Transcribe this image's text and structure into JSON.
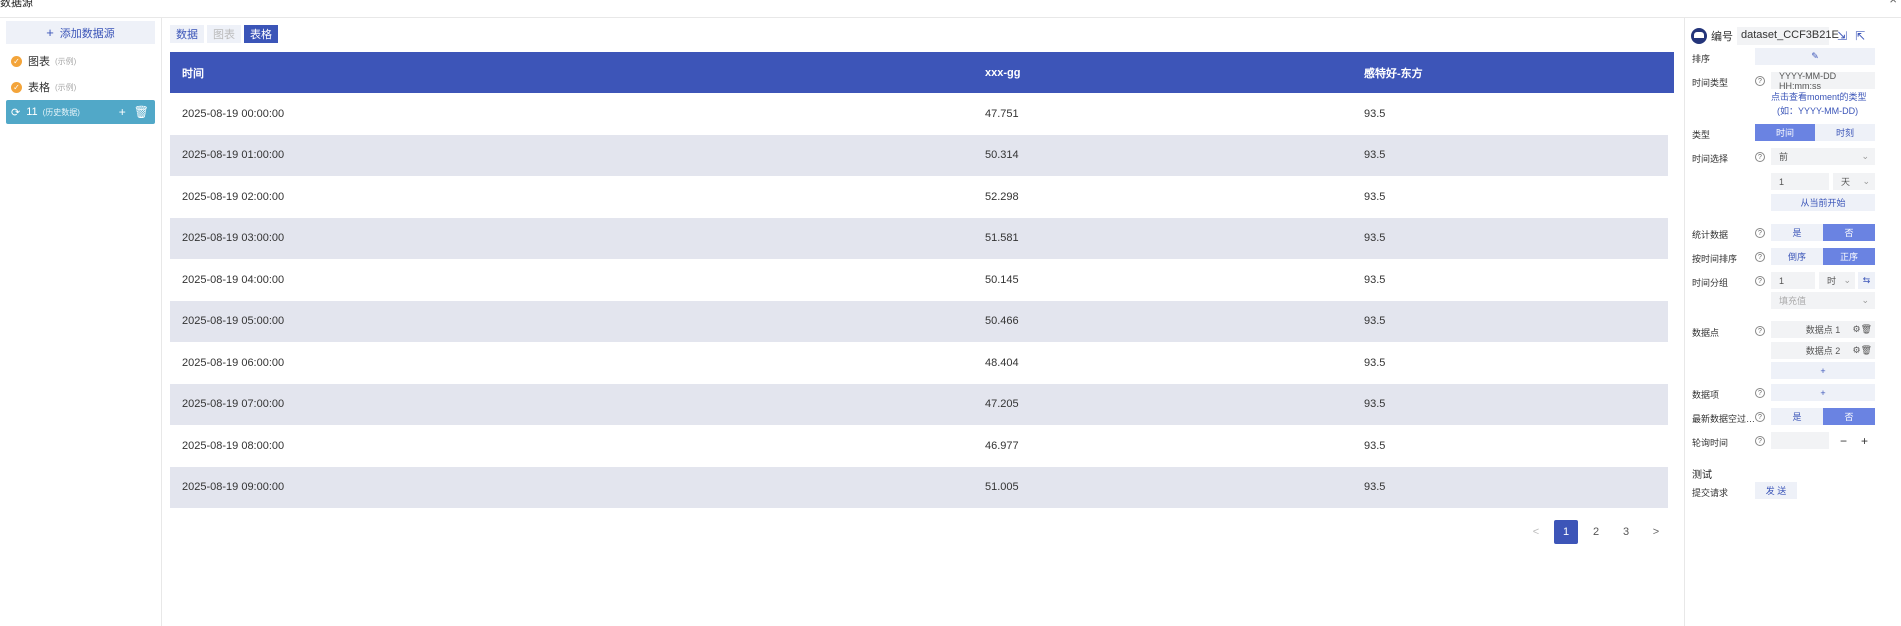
{
  "window": {
    "title": "数据源",
    "close_glyph": "×"
  },
  "sidebar": {
    "add_label": "添加数据源",
    "items": [
      {
        "label": "图表",
        "tag": "(示例)"
      },
      {
        "label": "表格",
        "tag": "(示例)"
      },
      {
        "label": "11",
        "tag": "(历史数据)"
      }
    ],
    "active_index": 2
  },
  "view_tabs": [
    {
      "label": "数据",
      "state": "normal"
    },
    {
      "label": "图表",
      "state": "disabled"
    },
    {
      "label": "表格",
      "state": "active"
    }
  ],
  "table": {
    "columns": [
      "时间",
      "xxx-gg",
      "感特好-东方"
    ],
    "rows": [
      [
        "2025-08-19 00:00:00",
        "47.751",
        "93.5"
      ],
      [
        "2025-08-19 01:00:00",
        "50.314",
        "93.5"
      ],
      [
        "2025-08-19 02:00:00",
        "52.298",
        "93.5"
      ],
      [
        "2025-08-19 03:00:00",
        "51.581",
        "93.5"
      ],
      [
        "2025-08-19 04:00:00",
        "50.145",
        "93.5"
      ],
      [
        "2025-08-19 05:00:00",
        "50.466",
        "93.5"
      ],
      [
        "2025-08-19 06:00:00",
        "48.404",
        "93.5"
      ],
      [
        "2025-08-19 07:00:00",
        "47.205",
        "93.5"
      ],
      [
        "2025-08-19 08:00:00",
        "46.977",
        "93.5"
      ],
      [
        "2025-08-19 09:00:00",
        "51.005",
        "93.5"
      ]
    ]
  },
  "pagination": {
    "prev": "<",
    "next": ">",
    "pages": [
      "1",
      "2",
      "3"
    ],
    "current": "1"
  },
  "panel": {
    "id_label": "编号",
    "id_value": "dataset_CCF3B21E",
    "sort_label": "排序",
    "time_type_label": "时间类型",
    "time_type_value": "YYYY-MM-DD HH:mm:ss",
    "moment_link": "点击查看moment的类型",
    "moment_example": "(如：YYYY-MM-DD)",
    "type_label": "类型",
    "type_options": [
      "时间",
      "时刻"
    ],
    "time_select_label": "时间选择",
    "time_select_value": "前",
    "count_value": "1",
    "unit_value": "天",
    "from_now_label": "从当前开始",
    "stats_label": "统计数据",
    "yes": "是",
    "no": "否",
    "order_label": "按时间排序",
    "order_options": [
      "倒序",
      "正序"
    ],
    "group_label": "时间分组",
    "group_count": "1",
    "group_unit": "时",
    "fill_placeholder": "填充值",
    "points_label": "数据点",
    "points": [
      "数据点 1",
      "数据点 2"
    ],
    "items_label": "数据项",
    "latest_label": "最新数据空过…",
    "poll_label": "轮询时间",
    "test_section": "测试",
    "submit_label": "提交请求",
    "send_label": "发 送"
  },
  "colors": {
    "accent": "#3d55b8",
    "active_tab": "#51a8c8",
    "toggle_on": "#6a83e2",
    "row_alt": "#e3e5ee"
  }
}
